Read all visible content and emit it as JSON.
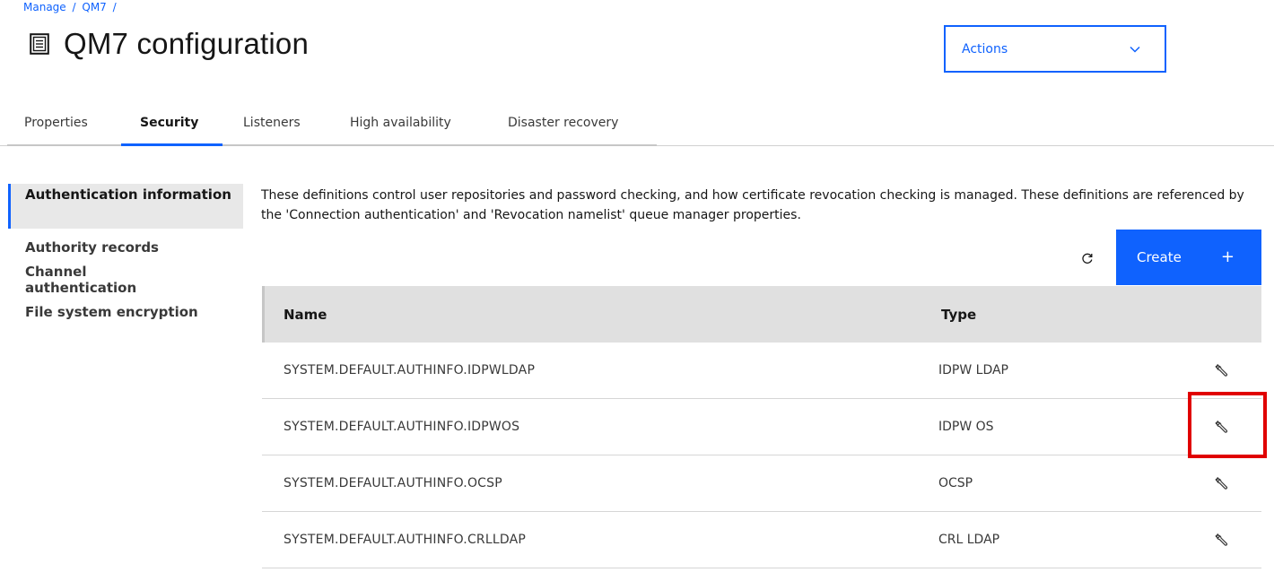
{
  "breadcrumb": {
    "items": [
      "Manage",
      "QM7"
    ],
    "separator": "/"
  },
  "header": {
    "title": "QM7 configuration",
    "icon": "document-icon"
  },
  "actions": {
    "label": "Actions"
  },
  "tabs": [
    {
      "label": "Properties",
      "active": false
    },
    {
      "label": "Security",
      "active": true
    },
    {
      "label": "Listeners",
      "active": false
    },
    {
      "label": "High availability",
      "active": false
    },
    {
      "label": "Disaster recovery",
      "active": false
    }
  ],
  "sidenav": {
    "items": [
      {
        "label": "Authentication information",
        "active": true
      },
      {
        "label": "Authority records",
        "active": false
      },
      {
        "label": "Channel authentication",
        "active": false
      },
      {
        "label": "File system encryption",
        "active": false
      }
    ]
  },
  "main": {
    "description": "These definitions control user repositories and password checking, and how certificate revocation checking is managed. These definitions are referenced by the 'Connection authentication' and 'Revocation namelist' queue manager properties.",
    "create_label": "Create",
    "create_icon": "+"
  },
  "table": {
    "columns": [
      "Name",
      "Type"
    ],
    "rows": [
      {
        "name": "SYSTEM.DEFAULT.AUTHINFO.IDPWLDAP",
        "type": "IDPW LDAP"
      },
      {
        "name": "SYSTEM.DEFAULT.AUTHINFO.IDPWOS",
        "type": "IDPW OS"
      },
      {
        "name": "SYSTEM.DEFAULT.AUTHINFO.OCSP",
        "type": "OCSP"
      },
      {
        "name": "SYSTEM.DEFAULT.AUTHINFO.CRLLDAP",
        "type": "CRL LDAP"
      }
    ]
  },
  "colors": {
    "accent": "#0f62fe",
    "highlight": "#e00000",
    "header_bg": "#e0e0e0"
  }
}
